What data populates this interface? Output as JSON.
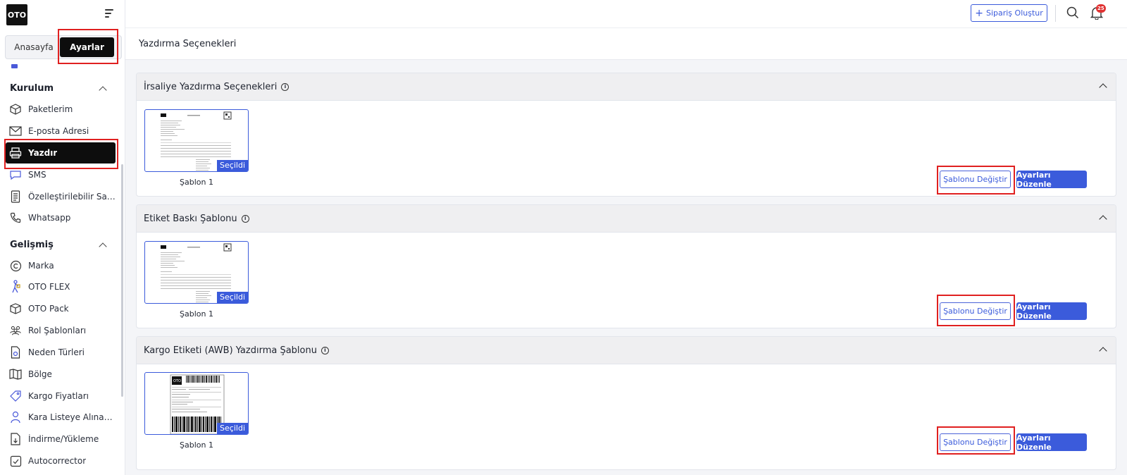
{
  "brand": {
    "logo_text": "OTO",
    "accent": "#3b5bdb",
    "highlight": "#e02020"
  },
  "sidebar": {
    "tabs": {
      "home": "Anasayfa",
      "settings": "Ayarlar"
    },
    "sections": [
      {
        "title": "Kurulum",
        "items": [
          "Paketlerim",
          "E-posta Adresi",
          "Yazdır",
          "SMS",
          "Özelleştirilebilir Sayfa…",
          "Whatsapp"
        ]
      },
      {
        "title": "Gelişmiş",
        "items": [
          "Marka",
          "OTO FLEX",
          "OTO Pack",
          "Rol Şablonları",
          "Neden Türleri",
          "Bölge",
          "Kargo Fiyatları",
          "Kara Listeye Alınan M…",
          "İndirme/Yükleme",
          "Autocorrector"
        ]
      }
    ],
    "active_item": "Yazdır"
  },
  "header": {
    "create_order": "Sipariş Oluştur",
    "notification_count": "25"
  },
  "page": {
    "title": "Yazdırma Seçenekleri"
  },
  "panels": [
    {
      "title": "İrsaliye Yazdırma Seçenekleri",
      "template_name": "Şablon 1",
      "selected_label": "Seçildi",
      "change_label": "Şablonu Değiştir",
      "edit_label": "Ayarları Düzenle"
    },
    {
      "title": "Etiket Baskı Şablonu",
      "template_name": "Şablon 1",
      "selected_label": "Seçildi",
      "change_label": "Şablonu Değiştir",
      "edit_label": "Ayarları Düzenle"
    },
    {
      "title": "Kargo Etiketi (AWB) Yazdırma Şablonu",
      "template_name": "Şablon 1",
      "selected_label": "Seçildi",
      "change_label": "Şablonu Değiştir",
      "edit_label": "Ayarları Düzenle"
    }
  ]
}
